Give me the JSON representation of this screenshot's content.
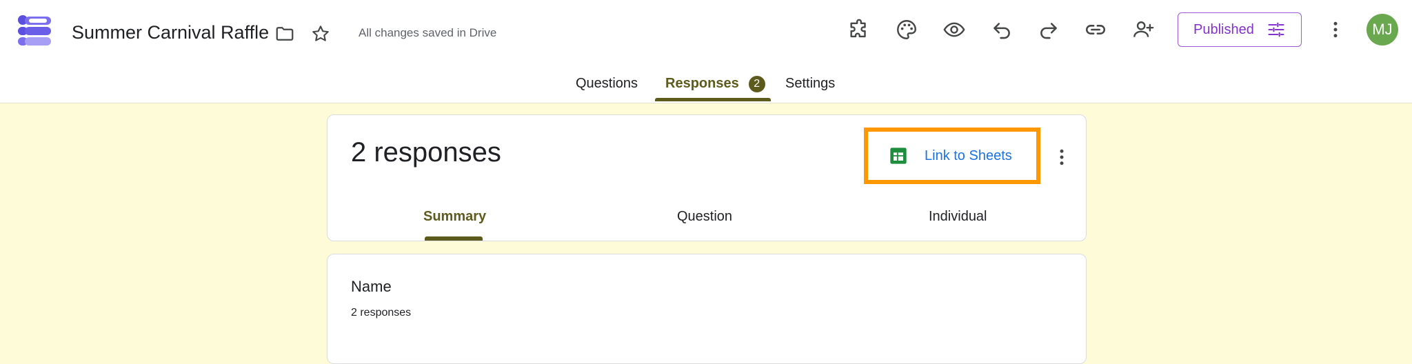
{
  "header": {
    "form_title": "Summer Carnival Raffle",
    "save_status": "All changes saved in Drive",
    "publish_label": "Published",
    "user_initials": "MJ",
    "avatar_color": "#6aa84f",
    "accent_color": "#8430ce",
    "icons": [
      "folder-icon",
      "star-icon",
      "add-ons-icon",
      "palette-icon",
      "preview-eye-icon",
      "undo-icon",
      "redo-icon",
      "link-icon",
      "add-collaborator-icon",
      "publish-settings-icon",
      "more-vert-icon"
    ]
  },
  "tabs": [
    {
      "label": "Questions",
      "active": false
    },
    {
      "label": "Responses",
      "active": true,
      "badge": "2"
    },
    {
      "label": "Settings",
      "active": false
    }
  ],
  "responses": {
    "title": "2 responses",
    "link_sheets_label": "Link to Sheets",
    "highlight_color": "#ff9800",
    "subtabs": [
      {
        "label": "Summary",
        "active": true
      },
      {
        "label": "Question",
        "active": false
      },
      {
        "label": "Individual",
        "active": false
      }
    ]
  },
  "question_summary": {
    "title": "Name",
    "count": "2 responses"
  }
}
